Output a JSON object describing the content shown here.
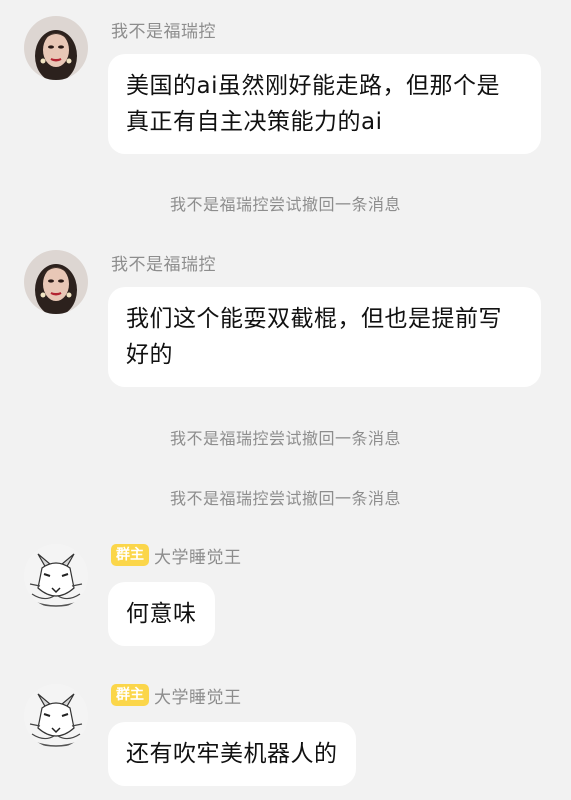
{
  "messages": [
    {
      "sender": "我不是福瑞控",
      "text": "美国的ai虽然刚好能走路，但那个是真正有自主决策能力的ai"
    },
    {
      "sender": "我不是福瑞控",
      "text": "我们这个能耍双截棍，但也是提前写好的"
    },
    {
      "sender": "大学睡觉王",
      "badge": "群主",
      "text": "何意味"
    },
    {
      "sender": "大学睡觉王",
      "badge": "群主",
      "text": "还有吹牢美机器人的"
    }
  ],
  "notices": [
    "我不是福瑞控尝试撤回一条消息",
    "我不是福瑞控尝试撤回一条消息",
    "我不是福瑞控尝试撤回一条消息"
  ],
  "colors": {
    "background": "#f2f2f2",
    "bubble": "#ffffff",
    "badge": "#fbd64a",
    "meta_text": "#8d8d8d"
  },
  "icons": {
    "avatar_1": "woman-portrait-avatar-icon",
    "avatar_2": "wolf-sketch-avatar-icon"
  }
}
